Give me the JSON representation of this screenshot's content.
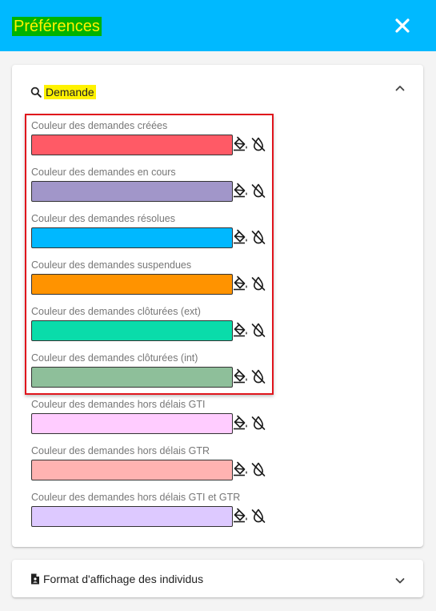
{
  "header": {
    "title": "Préférences",
    "close_icon": "close-icon"
  },
  "demande_section": {
    "title": "Demande",
    "search_icon": "search-icon",
    "expanded": true,
    "highlighted_rows": 6,
    "items": [
      {
        "label": "Couleur des demandes créées",
        "color": "#ff5a66"
      },
      {
        "label": "Couleur des demandes en cours",
        "color": "#a196c9"
      },
      {
        "label": "Couleur des demandes résolues",
        "color": "#00b8ff"
      },
      {
        "label": "Couleur des demandes suspendues",
        "color": "#ff9300"
      },
      {
        "label": "Couleur des demandes clôturées (ext)",
        "color": "#0adcaa"
      },
      {
        "label": "Couleur des demandes clôturées (int)",
        "color": "#8ebf9a"
      },
      {
        "label": "Couleur des demandes hors délais GTI",
        "color": "#ffccff"
      },
      {
        "label": "Couleur des demandes hors délais GTR",
        "color": "#ffb3b1"
      },
      {
        "label": "Couleur des demandes hors délais GTI et GTR",
        "color": "#ddc9ff"
      }
    ]
  },
  "format_section": {
    "title": "Format d'affichage des individus",
    "expanded": false
  },
  "colors": {
    "header_bg": "#00b9ff",
    "highlight_border": "#e0151c"
  }
}
